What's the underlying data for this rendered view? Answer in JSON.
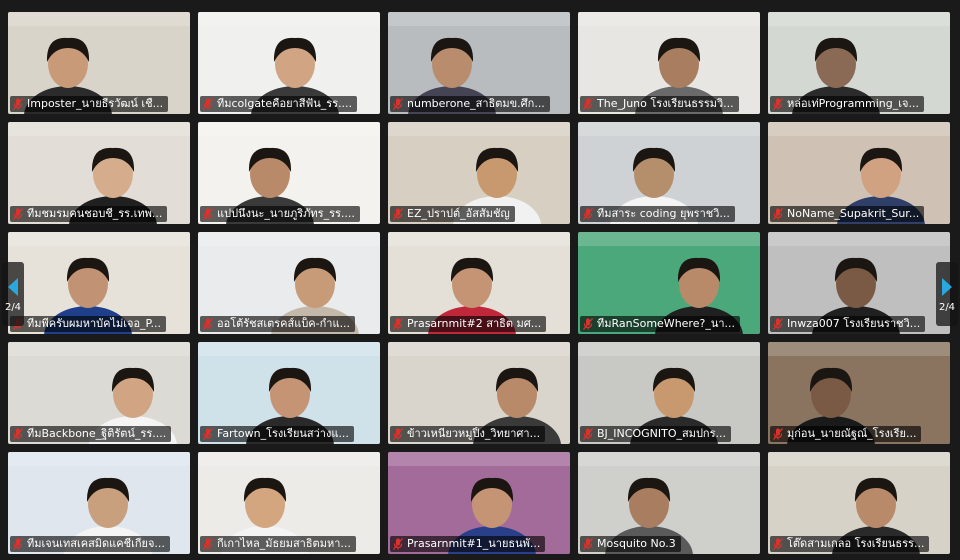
{
  "gallery": {
    "page_indicator_left": "2/4",
    "page_indicator_right": "2/4",
    "tiles": [
      {
        "name": "Imposter_นายธีรวัฒน์ เชื่...",
        "bg": "#d9d4c9",
        "skin": "#c99a78",
        "shirt": "#2b2b2b"
      },
      {
        "name": "ทีมcolgateคือยาสีฟัน_รร....",
        "bg": "#f0f0ee",
        "skin": "#d1a584",
        "shirt": "#3a3a3a"
      },
      {
        "name": "numberone_สาธิตมข.ศึก...",
        "bg": "#b8bcbf",
        "skin": "#b88c6c",
        "shirt": "#445"
      },
      {
        "name": "The_Juno โรงเรียนธรรมวิ...",
        "bg": "#e8e6e2",
        "skin": "#a87d60",
        "shirt": "#6a6a6a"
      },
      {
        "name": "หล่อเท่Programming_เจ...",
        "bg": "#d4d8d2",
        "skin": "#8a6a55",
        "shirt": "#2b2b2b"
      },
      {
        "name": "ทีมชมรมคนชอบชี_รร.เทพ...",
        "bg": "#e2ddd6",
        "skin": "#d6ad8c",
        "shirt": "#202020"
      },
      {
        "name": "แปปนึงนะ_นายภูริภัทร_รร....",
        "bg": "#f4f2ee",
        "skin": "#b88a6a",
        "shirt": "#3a3a3a"
      },
      {
        "name": "EZ_ปราปต์_อัสสัมชัญ",
        "bg": "#d7cfc2",
        "skin": "#c8986f",
        "shirt": "#f1f1f1"
      },
      {
        "name": "ทีมสาระ coding ยุพราชวิ...",
        "bg": "#cfd2d4",
        "skin": "#b58e6c",
        "shirt": "#f4f4f4"
      },
      {
        "name": "NoName_Supakrit_Sur...",
        "bg": "#cfc2b4",
        "skin": "#d0a282",
        "shirt": "#2f3f6a"
      },
      {
        "name": "ทีมพี่ครับผมหาบัคไม่เจอ_P...",
        "bg": "#e6e2da",
        "skin": "#c19274",
        "shirt": "#1f3f8a"
      },
      {
        "name": "ออโต้รัชสเตรคส์แบ็ค-กำแ...",
        "bg": "#e9ebec",
        "skin": "#c79a78",
        "shirt": "#c4b8aa"
      },
      {
        "name": "Prasarnmit#2 สาธิต มศ...",
        "bg": "#e4e0d8",
        "skin": "#c49474",
        "shirt": "#c0283a"
      },
      {
        "name": "ทีมRanSomeWhere?_นา...",
        "bg": "#4aa87a",
        "skin": "#b88a6a",
        "shirt": "#202020"
      },
      {
        "name": "Inwza007 โรงเรียนราชวิ...",
        "bg": "#bfbfbf",
        "skin": "#7a5a45",
        "shirt": "#202020"
      },
      {
        "name": "ทีมBackbone_ฐิติรัตน์_รร....",
        "bg": "#dcdad4",
        "skin": "#d1a584",
        "shirt": "#f4f4f4"
      },
      {
        "name": "Fartown_โรงเรียนสว่างแ...",
        "bg": "#cfe2ea",
        "skin": "#c49474",
        "shirt": "#2a2a2a"
      },
      {
        "name": "ข้าวเหนียวหมูปิ้ง_วิทยาศา...",
        "bg": "#dad5cc",
        "skin": "#b88a6a",
        "shirt": "#3a3a3a"
      },
      {
        "name": "BJ_INCOGNITO_สมปกร...",
        "bg": "#c8c8c4",
        "skin": "#c8986f",
        "shirt": "#2a2a2a"
      },
      {
        "name": "มุก่อน_นายณัฐณ์_โรงเรีย...",
        "bg": "#8a7460",
        "skin": "#7a5a45",
        "shirt": "#1a1a1a"
      },
      {
        "name": "ทีมเจนเทสเคสมิดแคชี่เกียจ...",
        "bg": "#dfe6ee",
        "skin": "#c9a07e",
        "shirt": "#f4f4f4"
      },
      {
        "name": "กีเกาไหล_มัธยมสาธิตมหา...",
        "bg": "#ecebe8",
        "skin": "#d4a680",
        "shirt": "#f4f4f4"
      },
      {
        "name": "Prasarnmit#1_นายธนพั...",
        "bg": "#a36b9a",
        "skin": "#c49474",
        "shirt": "#2a3f8a"
      },
      {
        "name": "Mosquito No.3",
        "bg": "#cfcfcc",
        "skin": "#a87d60",
        "shirt": "#5a5a5a"
      },
      {
        "name": "โต๊ดสามเกลอ โรงเรียนธรร...",
        "bg": "#d6d2c8",
        "skin": "#b88a6a",
        "shirt": "#2a2a2a"
      }
    ]
  },
  "colors": {
    "muted_mic": "#e0302a",
    "background": "#1a1a1a"
  },
  "icons": {
    "muted": "muted-microphone-icon",
    "prev": "chevron-left-icon",
    "next": "chevron-right-icon"
  }
}
